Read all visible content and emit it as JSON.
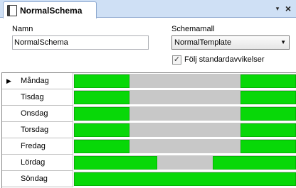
{
  "tab": {
    "title": "NormalSchema",
    "icon": "schedule-document-icon"
  },
  "toolbar": {
    "dropdown_glyph": "▾",
    "close_glyph": "×"
  },
  "form": {
    "name_label": "Namn",
    "name_value": "NormalSchema",
    "template_label": "Schemamall",
    "template_value": "NormalTemplate",
    "template_arrow": "▼",
    "follow_label": "Följ standardavvikelser",
    "follow_checked_glyph": "✓"
  },
  "days": [
    {
      "label": "Måndag",
      "current": true,
      "segments": [
        [
          0,
          0.25
        ],
        [
          0.75,
          1.0
        ]
      ]
    },
    {
      "label": "Tisdag",
      "current": false,
      "segments": [
        [
          0,
          0.25
        ],
        [
          0.75,
          1.0
        ]
      ]
    },
    {
      "label": "Onsdag",
      "current": false,
      "segments": [
        [
          0,
          0.25
        ],
        [
          0.75,
          1.0
        ]
      ]
    },
    {
      "label": "Torsdag",
      "current": false,
      "segments": [
        [
          0,
          0.25
        ],
        [
          0.75,
          1.0
        ]
      ]
    },
    {
      "label": "Fredag",
      "current": false,
      "segments": [
        [
          0,
          0.25
        ],
        [
          0.75,
          1.0
        ]
      ]
    },
    {
      "label": "Lördag",
      "current": false,
      "segments": [
        [
          0,
          0.375
        ],
        [
          0.625,
          1.0
        ]
      ]
    },
    {
      "label": "Söndag",
      "current": false,
      "segments": [
        [
          0,
          1.0
        ]
      ]
    }
  ],
  "current_row_glyph": "▶",
  "colors": {
    "active_segment": "#08d808",
    "inactive_track": "#c8c8c8",
    "tab_strip": "#cfe0f5"
  }
}
